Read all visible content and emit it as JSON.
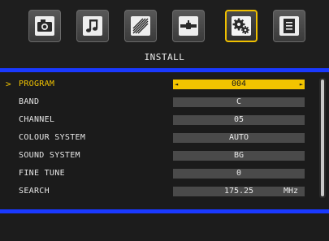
{
  "tabs": [
    {
      "icon": "camera-icon"
    },
    {
      "icon": "music-note-icon"
    },
    {
      "icon": "picture-adjust-icon"
    },
    {
      "icon": "connector-icon"
    },
    {
      "icon": "gear-icon",
      "active": true
    },
    {
      "icon": "document-icon"
    }
  ],
  "header": {
    "title": "INSTALL"
  },
  "menu": {
    "items": [
      {
        "label": "PROGRAM",
        "value": "004",
        "selected": true
      },
      {
        "label": "BAND",
        "value": "C"
      },
      {
        "label": "CHANNEL",
        "value": "05"
      },
      {
        "label": "COLOUR SYSTEM",
        "value": "AUTO"
      },
      {
        "label": "SOUND SYSTEM",
        "value": "BG"
      },
      {
        "label": "FINE TUNE",
        "value": "0"
      },
      {
        "label": "SEARCH",
        "value": "175.25",
        "unit": "MHz"
      }
    ]
  },
  "colors": {
    "accent": "#f2c400",
    "divider": "#1a39ff",
    "background": "#1b1b1b"
  }
}
